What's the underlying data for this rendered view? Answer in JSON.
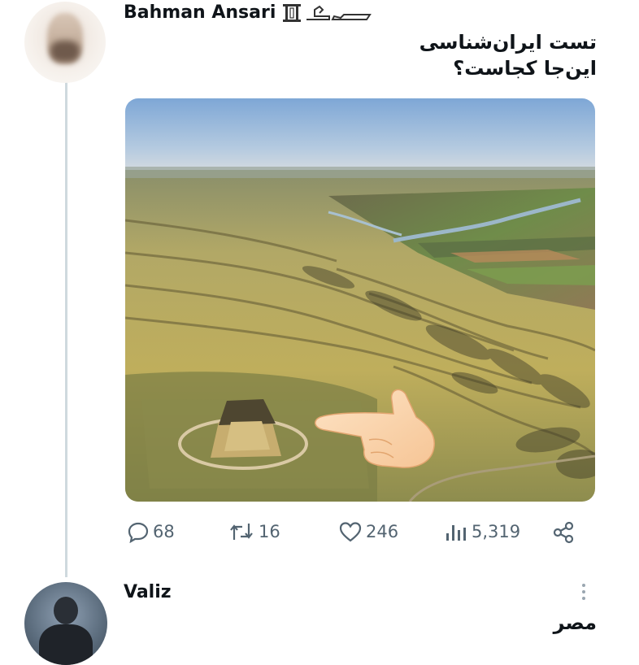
{
  "tweet": {
    "author_name": "Bahman Ansari",
    "text_line1": "تست ایران‌شناسی",
    "text_line2": "این‌جا کجاست؟",
    "stats": {
      "replies": "68",
      "retweets": "16",
      "likes": "246",
      "views": "5,319"
    }
  },
  "reply": {
    "author_name": "Valiz",
    "text": "مصر"
  },
  "colors": {
    "text": "#0f1419",
    "muted": "#536471",
    "thread_line": "#cfd9de"
  },
  "icons": [
    "reply-icon",
    "retweet-icon",
    "like-icon",
    "views-icon",
    "share-icon",
    "more-icon"
  ]
}
